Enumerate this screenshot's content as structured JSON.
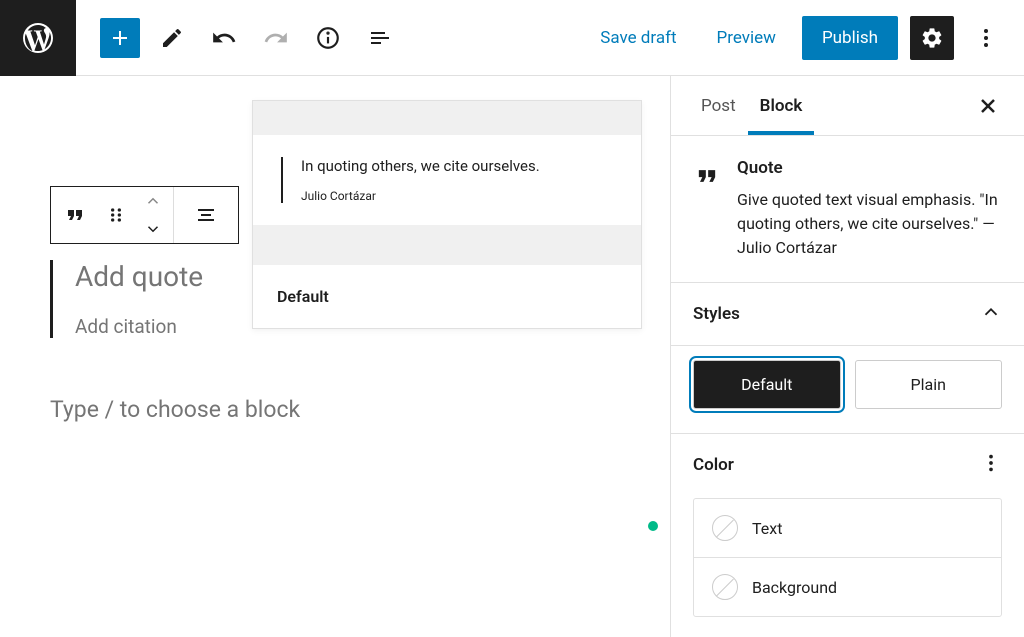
{
  "topbar": {
    "save_draft": "Save draft",
    "preview": "Preview",
    "publish": "Publish"
  },
  "preview_card": {
    "quote": "In quoting others, we cite ourselves.",
    "citation": "Julio Cortázar",
    "style_label": "Default"
  },
  "quote_block": {
    "add_quote": "Add quote",
    "add_citation": "Add citation"
  },
  "paragraph_placeholder": "Type / to choose a block",
  "sidebar": {
    "tab_post": "Post",
    "tab_block": "Block",
    "block_title": "Quote",
    "block_desc": "Give quoted text visual emphasis. \"In quoting others, we cite ourselves.\" — Julio Cortázar",
    "panel_styles": "Styles",
    "style_default": "Default",
    "style_plain": "Plain",
    "panel_color": "Color",
    "color_text": "Text",
    "color_bg": "Background"
  }
}
